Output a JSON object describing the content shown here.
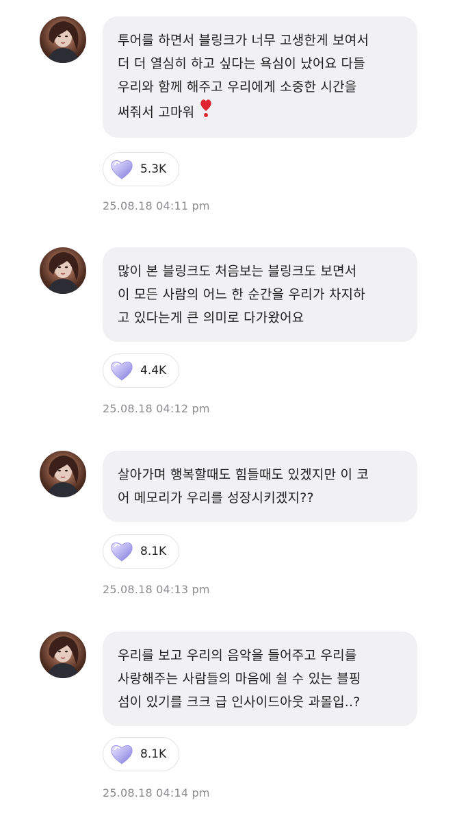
{
  "messages": [
    {
      "text": "투어를 하면서 블링크가 너무 고생한게 보여서\n더 더 열심히 하고 싶다는 욕심이 났어요 다들\n우리와 함께 해주고 우리에게 소중한 시간을\n써줘서 고마워",
      "emoji": "heavy-heart-exclamation",
      "reaction_icon": "crystal-heart-icon",
      "reaction_count": "5.3K",
      "timestamp": "25.08.18 04:11 pm"
    },
    {
      "text": "많이 본 블링크도 처음보는 블링크도 보면서\n이 모든 사람의 어느 한 순간을 우리가 차지하\n고 있다는게 큰 의미로 다가왔어요",
      "reaction_icon": "crystal-heart-icon",
      "reaction_count": "4.4K",
      "timestamp": "25.08.18 04:12 pm"
    },
    {
      "text": "살아가며 행복할때도 힘들때도 있겠지만 이 코\n어 메모리가 우리를 성장시키겠지??",
      "reaction_icon": "crystal-heart-icon",
      "reaction_count": "8.1K",
      "timestamp": "25.08.18 04:13 pm"
    },
    {
      "text": "우리를 보고 우리의 음악을 들어주고 우리를\n사랑해주는 사람들의 마음에 쉴 수 있는 블핑\n섬이 있기를 크크 급 인사이드아웃 과몰입..?",
      "reaction_icon": "crystal-heart-icon",
      "reaction_count": "8.1K",
      "timestamp": "25.08.18 04:14 pm"
    }
  ],
  "colors": {
    "bubble": "#f1f1f3",
    "timestamp": "#8b8b90",
    "reaction_border": "#e3e3e6",
    "heart_purple": "#b7b2f0",
    "emoji_red": "#e0242f"
  }
}
